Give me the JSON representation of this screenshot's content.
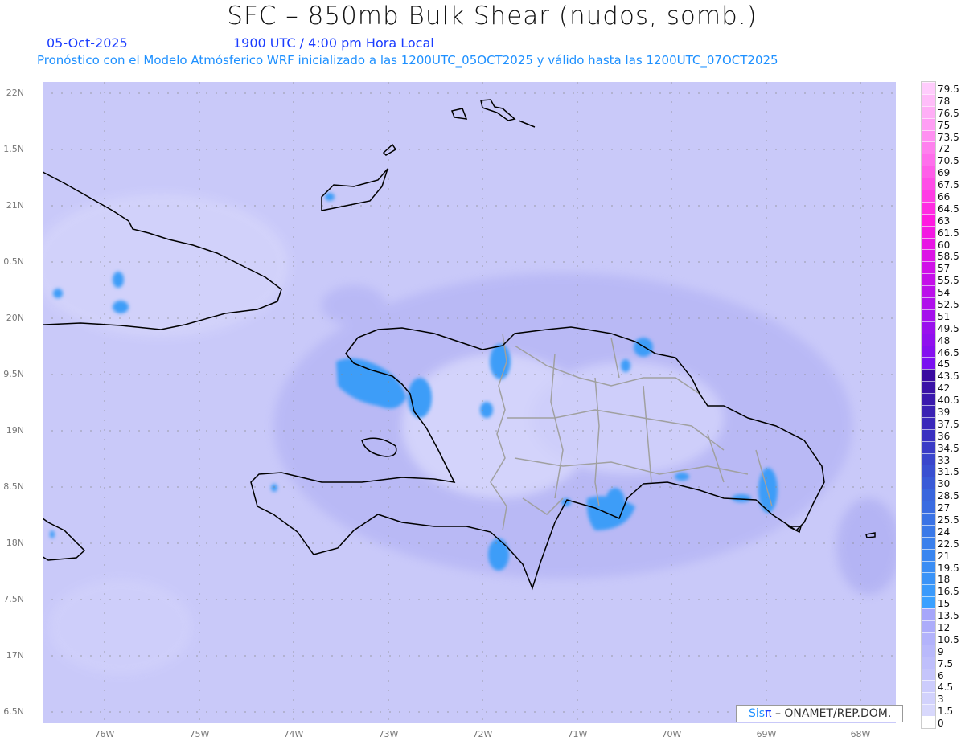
{
  "header": {
    "title": "SFC – 850mb Bulk Shear (nudos, somb.)",
    "date": "05-Oct-2025",
    "time": "1900 UTC / 4:00 pm Hora Local",
    "subtitle": "Pronóstico con el Modelo Atmósferico WRF inicializado a las 1200UTC_05OCT2025 y válido hasta las  1200UTC_07OCT2025"
  },
  "axes": {
    "y_labels": [
      "22N",
      "1.5N",
      "21N",
      "0.5N",
      "20N",
      "9.5N",
      "19N",
      "8.5N",
      "18N",
      "7.5N",
      "17N",
      "6.5N"
    ],
    "x_labels": [
      "76W",
      "75W",
      "74W",
      "73W",
      "72W",
      "71W",
      "70W",
      "69W",
      "68W"
    ]
  },
  "colorbar": {
    "labels": [
      "0",
      "1.5",
      "3",
      "4.5",
      "6",
      "7.5",
      "9",
      "10.5",
      "12",
      "13.5",
      "15",
      "16.5",
      "18",
      "19.5",
      "21",
      "22.5",
      "24",
      "25.5",
      "27",
      "28.5",
      "30",
      "31.5",
      "33",
      "34.5",
      "36",
      "37.5",
      "39",
      "40.5",
      "42",
      "43.5",
      "45",
      "46.5",
      "48",
      "49.5",
      "51",
      "52.5",
      "54",
      "55.5",
      "57",
      "58.5",
      "60",
      "61.5",
      "63",
      "64.5",
      "66",
      "67.5",
      "69",
      "70.5",
      "72",
      "73.5",
      "75",
      "76.5",
      "78",
      "79.5"
    ],
    "color_stops": [
      "#ffffff",
      "#d8d8fc",
      "#a6a6fa",
      "#3aa0ff",
      "#3a66dd",
      "#3a30c0",
      "#3a0aa0",
      "#7a10f0",
      "#d010e8",
      "#ff1ae0",
      "#ff80ee",
      "#ffccfc"
    ]
  },
  "colors": {
    "background": "#c9c9f9",
    "shear_blue": "#3d9df8",
    "coast": "#000000",
    "borders": "#a0a0a0"
  },
  "footer": {
    "logo_sis": "Sis",
    "logo_pi": "π",
    "logo_text": " –  ONAMET/REP.DOM."
  }
}
